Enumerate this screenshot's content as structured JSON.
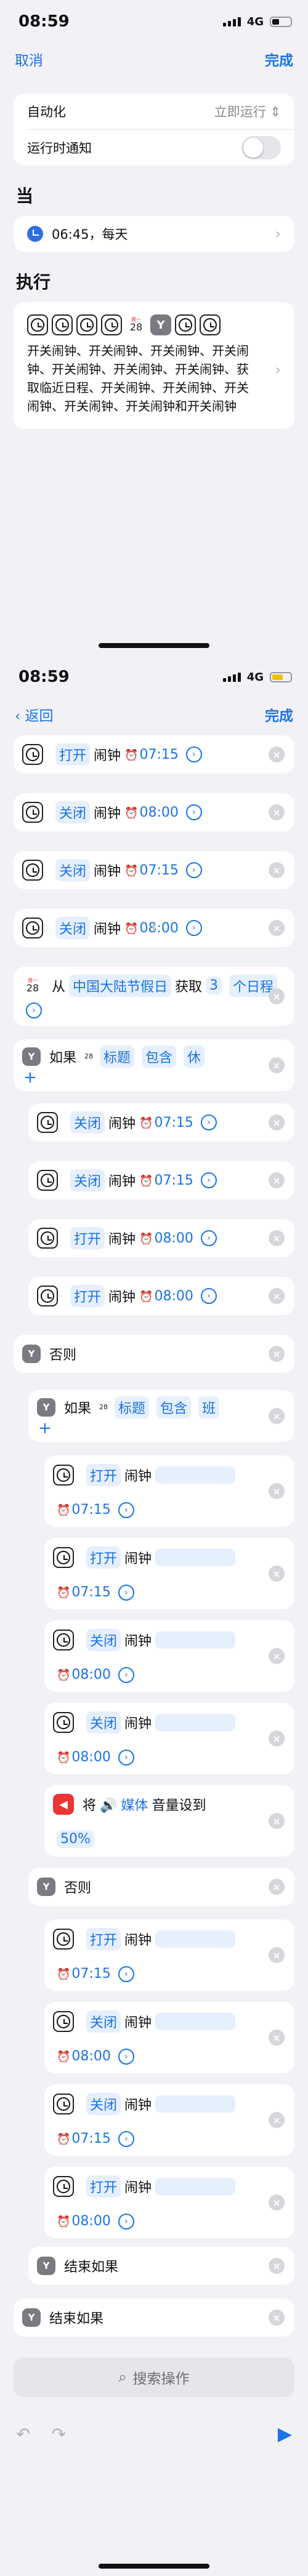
{
  "status": {
    "time": "08:59",
    "network": "4G"
  },
  "screen1": {
    "nav": {
      "cancel": "取消",
      "done": "完成"
    },
    "automation_label": "自动化",
    "automation_value": "立即运行",
    "automation_chev": "⌃",
    "notify_label": "运行时通知",
    "when_title": "当",
    "when_value": "06:45，每天",
    "exec_title": "执行",
    "cal_month": "周一",
    "cal_day": "28",
    "exec_text": "开关闹钟、开关闹钟、开关闹钟、开关闹钟、开关闹钟、开关闹钟、开关闹钟、获取临近日程、开关闹钟、开关闹钟、开关闹钟、开关闹钟、开关闹钟和开关闹钟"
  },
  "screen2": {
    "nav": {
      "back": "返回",
      "done": "完成"
    },
    "actions": [
      {
        "verb": "打开",
        "noun": "闹钟",
        "time": "07:15"
      },
      {
        "verb": "关闭",
        "noun": "闹钟",
        "time": "08:00"
      },
      {
        "verb": "关闭",
        "noun": "闹钟",
        "time": "07:15"
      },
      {
        "verb": "关闭",
        "noun": "闹钟",
        "time": "08:00"
      }
    ],
    "get": {
      "from": "从",
      "src": "中国大陆节假日",
      "get": "获取",
      "count": "3",
      "unit": "个日程"
    },
    "if1": {
      "label": "如果",
      "field": "标题",
      "op": "包含",
      "val": "休"
    },
    "inner1": [
      {
        "verb": "关闭",
        "noun": "闹钟",
        "time": "07:15"
      },
      {
        "verb": "关闭",
        "noun": "闹钟",
        "time": "07:15"
      },
      {
        "verb": "打开",
        "noun": "闹钟",
        "time": "08:00"
      },
      {
        "verb": "打开",
        "noun": "闹钟",
        "time": "08:00"
      }
    ],
    "else1": "否则",
    "if2": {
      "label": "如果",
      "field": "标题",
      "op": "包含",
      "val": "班"
    },
    "inner2": [
      {
        "verb": "打开",
        "noun": "闹钟",
        "time": "07:15"
      },
      {
        "verb": "打开",
        "noun": "闹钟",
        "time": "07:15"
      },
      {
        "verb": "关闭",
        "noun": "闹钟",
        "time": "08:00"
      },
      {
        "verb": "关闭",
        "noun": "闹钟",
        "time": "08:00"
      }
    ],
    "volume": {
      "verb": "将",
      "target": "媒体",
      "mid": "音量设到",
      "val": "50%"
    },
    "else2": "否则",
    "inner3": [
      {
        "verb": "打开",
        "noun": "闹钟",
        "time": "07:15"
      },
      {
        "verb": "关闭",
        "noun": "闹钟",
        "time": "08:00"
      },
      {
        "verb": "关闭",
        "noun": "闹钟",
        "time": "07:15"
      },
      {
        "verb": "打开",
        "noun": "闹钟",
        "time": "08:00"
      }
    ],
    "endif_inner": "结束如果",
    "endif_outer": "结束如果",
    "search": "搜索操作"
  }
}
